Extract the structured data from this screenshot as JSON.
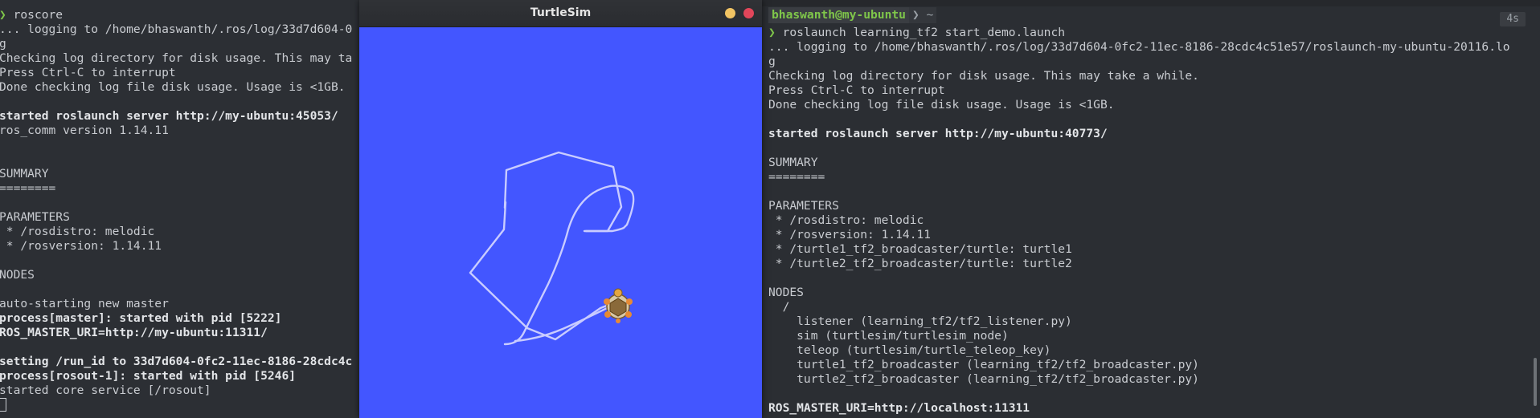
{
  "left_terminal": {
    "lines": [
      {
        "text": "❯ roscore",
        "style": "prompt"
      },
      {
        "text": "... logging to /home/bhaswanth/.ros/log/33d7d604-0",
        "style": "normal"
      },
      {
        "text": "g",
        "style": "normal"
      },
      {
        "text": "Checking log directory for disk usage. This may ta",
        "style": "normal"
      },
      {
        "text": "Press Ctrl-C to interrupt",
        "style": "normal"
      },
      {
        "text": "Done checking log file disk usage. Usage is <1GB.",
        "style": "normal"
      },
      {
        "text": "",
        "style": "normal"
      },
      {
        "text": "started roslaunch server http://my-ubuntu:45053/",
        "style": "bold"
      },
      {
        "text": "ros_comm version 1.14.11",
        "style": "normal"
      },
      {
        "text": "",
        "style": "normal"
      },
      {
        "text": "",
        "style": "normal"
      },
      {
        "text": "SUMMARY",
        "style": "normal"
      },
      {
        "text": "========",
        "style": "normal"
      },
      {
        "text": "",
        "style": "normal"
      },
      {
        "text": "PARAMETERS",
        "style": "normal"
      },
      {
        "text": " * /rosdistro: melodic",
        "style": "normal"
      },
      {
        "text": " * /rosversion: 1.14.11",
        "style": "normal"
      },
      {
        "text": "",
        "style": "normal"
      },
      {
        "text": "NODES",
        "style": "normal"
      },
      {
        "text": "",
        "style": "normal"
      },
      {
        "text": "auto-starting new master",
        "style": "normal"
      },
      {
        "text": "process[master]: started with pid [5222]",
        "style": "bold"
      },
      {
        "text": "ROS_MASTER_URI=http://my-ubuntu:11311/",
        "style": "bold"
      },
      {
        "text": "",
        "style": "normal"
      },
      {
        "text": "setting /run_id to 33d7d604-0fc2-11ec-8186-28cdc4c",
        "style": "bold"
      },
      {
        "text": "process[rosout-1]: started with pid [5246]",
        "style": "bold"
      },
      {
        "text": "started core service [/rosout]",
        "style": "normal"
      }
    ]
  },
  "turtlesim": {
    "title": "TurtleSim",
    "background": "#4356ff",
    "path_color": "#c9ccff"
  },
  "right_terminal": {
    "user_host": "bhaswanth@my-ubuntu",
    "dir": "~",
    "duration": "4s",
    "lines": [
      {
        "text": "❯ roslaunch learning_tf2 start_demo.launch",
        "style": "prompt"
      },
      {
        "text": "... logging to /home/bhaswanth/.ros/log/33d7d604-0fc2-11ec-8186-28cdc4c51e57/roslaunch-my-ubuntu-20116.lo",
        "style": "normal"
      },
      {
        "text": "g",
        "style": "normal"
      },
      {
        "text": "Checking log directory for disk usage. This may take a while.",
        "style": "normal"
      },
      {
        "text": "Press Ctrl-C to interrupt",
        "style": "normal"
      },
      {
        "text": "Done checking log file disk usage. Usage is <1GB.",
        "style": "normal"
      },
      {
        "text": "",
        "style": "normal"
      },
      {
        "text": "started roslaunch server http://my-ubuntu:40773/",
        "style": "bold"
      },
      {
        "text": "",
        "style": "normal"
      },
      {
        "text": "SUMMARY",
        "style": "normal"
      },
      {
        "text": "========",
        "style": "normal"
      },
      {
        "text": "",
        "style": "normal"
      },
      {
        "text": "PARAMETERS",
        "style": "normal"
      },
      {
        "text": " * /rosdistro: melodic",
        "style": "normal"
      },
      {
        "text": " * /rosversion: 1.14.11",
        "style": "normal"
      },
      {
        "text": " * /turtle1_tf2_broadcaster/turtle: turtle1",
        "style": "normal"
      },
      {
        "text": " * /turtle2_tf2_broadcaster/turtle: turtle2",
        "style": "normal"
      },
      {
        "text": "",
        "style": "normal"
      },
      {
        "text": "NODES",
        "style": "normal"
      },
      {
        "text": "  /",
        "style": "normal"
      },
      {
        "text": "    listener (learning_tf2/tf2_listener.py)",
        "style": "normal"
      },
      {
        "text": "    sim (turtlesim/turtlesim_node)",
        "style": "normal"
      },
      {
        "text": "    teleop (turtlesim/turtle_teleop_key)",
        "style": "normal"
      },
      {
        "text": "    turtle1_tf2_broadcaster (learning_tf2/tf2_broadcaster.py)",
        "style": "normal"
      },
      {
        "text": "    turtle2_tf2_broadcaster (learning_tf2/tf2_broadcaster.py)",
        "style": "normal"
      },
      {
        "text": "",
        "style": "normal"
      },
      {
        "text": "ROS_MASTER_URI=http://localhost:11311",
        "style": "bold"
      }
    ]
  }
}
